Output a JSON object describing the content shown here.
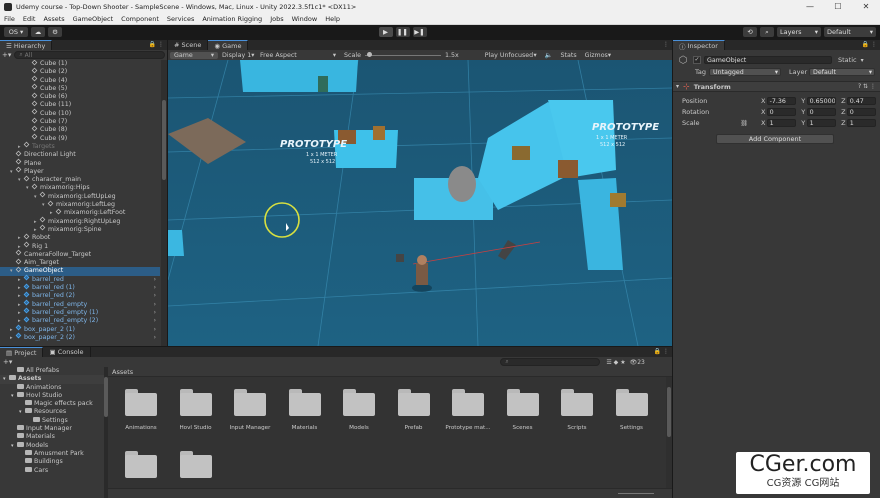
{
  "window": {
    "title": "Udemy course - Top-Down Shooter - SampleScene - Windows, Mac, Linux - Unity 2022.3.5f1c1* <DX11>"
  },
  "menu": [
    "File",
    "Edit",
    "Assets",
    "GameObject",
    "Component",
    "Services",
    "Animation Rigging",
    "Jobs",
    "Window",
    "Help"
  ],
  "toolbar": {
    "account": "OS",
    "layers": "Layers",
    "layout": "Default"
  },
  "hierarchy": {
    "tab": "Hierarchy",
    "search": "All",
    "rows": [
      {
        "t": "Cube (1)",
        "i": 4,
        "k": "n"
      },
      {
        "t": "Cube (2)",
        "i": 4,
        "k": "n"
      },
      {
        "t": "Cube (4)",
        "i": 4,
        "k": "n"
      },
      {
        "t": "Cube (5)",
        "i": 4,
        "k": "n"
      },
      {
        "t": "Cube (6)",
        "i": 4,
        "k": "n"
      },
      {
        "t": "Cube (11)",
        "i": 4,
        "k": "n"
      },
      {
        "t": "Cube (10)",
        "i": 4,
        "k": "n"
      },
      {
        "t": "Cube (7)",
        "i": 4,
        "k": "n"
      },
      {
        "t": "Cube (8)",
        "i": 4,
        "k": "n"
      },
      {
        "t": "Cube (9)",
        "i": 4,
        "k": "n"
      },
      {
        "t": "Targets",
        "i": 3,
        "k": "d",
        "a": "▸"
      },
      {
        "t": "Directional Light",
        "i": 2,
        "k": "n"
      },
      {
        "t": "Plane",
        "i": 2,
        "k": "n"
      },
      {
        "t": "Player",
        "i": 2,
        "k": "n",
        "a": "▾"
      },
      {
        "t": "character_main",
        "i": 3,
        "k": "n",
        "a": "▾"
      },
      {
        "t": "mixamorig:Hips",
        "i": 4,
        "k": "n",
        "a": "▾"
      },
      {
        "t": "mixamorig:LeftUpLeg",
        "i": 5,
        "k": "n",
        "a": "▾"
      },
      {
        "t": "mixamorig:LeftLeg",
        "i": 6,
        "k": "n",
        "a": "▾"
      },
      {
        "t": "mixamorig:LeftFoot",
        "i": 7,
        "k": "n",
        "a": "▸"
      },
      {
        "t": "mixamorig:RightUpLeg",
        "i": 5,
        "k": "n",
        "a": "▸"
      },
      {
        "t": "mixamorig:Spine",
        "i": 5,
        "k": "n",
        "a": "▸"
      },
      {
        "t": "Robot",
        "i": 3,
        "k": "n",
        "a": "▸"
      },
      {
        "t": "Rig 1",
        "i": 3,
        "k": "n",
        "a": "▸"
      },
      {
        "t": "CameraFollow_Target",
        "i": 2,
        "k": "n"
      },
      {
        "t": "Aim_Target",
        "i": 2,
        "k": "n"
      },
      {
        "t": "GameObject",
        "i": 2,
        "k": "s",
        "a": "▾"
      },
      {
        "t": "barrel_red",
        "i": 3,
        "k": "p",
        "a": "▸"
      },
      {
        "t": "barrel_red (1)",
        "i": 3,
        "k": "p",
        "a": "▸"
      },
      {
        "t": "barrel_red (2)",
        "i": 3,
        "k": "p",
        "a": "▸"
      },
      {
        "t": "barrel_red_empty",
        "i": 3,
        "k": "p",
        "a": "▸"
      },
      {
        "t": "barrel_red_empty (1)",
        "i": 3,
        "k": "p",
        "a": "▸"
      },
      {
        "t": "barrel_red_empty (2)",
        "i": 3,
        "k": "p",
        "a": "▸"
      },
      {
        "t": "box_paper_2 (1)",
        "i": 2,
        "k": "p",
        "a": "▸"
      },
      {
        "t": "box_paper_2 (2)",
        "i": 2,
        "k": "p",
        "a": "▸"
      }
    ]
  },
  "game": {
    "tabs": [
      "Scene",
      "Game"
    ],
    "mode": "Game",
    "display": "Display 1",
    "aspect": "Free Aspect",
    "scale_label": "Scale",
    "scale_value": "1.5x",
    "play_mode": "Play Unfocused",
    "stats": "Stats",
    "gizmos": "Gizmos",
    "labels": [
      "PROTOTYPE",
      "1 x 1 METER",
      "512 x 512"
    ]
  },
  "inspector": {
    "tab": "Inspector",
    "name": "GameObject",
    "static": "Static",
    "tag_label": "Tag",
    "tag": "Untagged",
    "layer_label": "Layer",
    "layer": "Default",
    "component": "Transform",
    "position": {
      "label": "Position",
      "x": "-7.36",
      "y": "0.650000",
      "z": "0.47"
    },
    "rotation": {
      "label": "Rotation",
      "x": "0",
      "y": "0",
      "z": "0"
    },
    "scale": {
      "label": "Scale",
      "x": "1",
      "y": "1",
      "z": "1"
    },
    "axes": [
      "X",
      "Y",
      "Z"
    ],
    "add_component": "Add Component"
  },
  "project": {
    "tabs": [
      "Project",
      "Console"
    ],
    "tree": [
      {
        "t": "All Prefabs",
        "i": 1
      },
      {
        "t": "Assets",
        "i": 0,
        "a": "▾",
        "b": true
      },
      {
        "t": "Animations",
        "i": 1
      },
      {
        "t": "Hovl Studio",
        "i": 1,
        "a": "▾"
      },
      {
        "t": "Magic effects pack",
        "i": 2
      },
      {
        "t": "Resources",
        "i": 2,
        "a": "▾"
      },
      {
        "t": "Settings",
        "i": 3
      },
      {
        "t": "Input Manager",
        "i": 1
      },
      {
        "t": "Materials",
        "i": 1
      },
      {
        "t": "Models",
        "i": 1,
        "a": "▾"
      },
      {
        "t": "Amusment Park",
        "i": 2
      },
      {
        "t": "Buildings",
        "i": 2
      },
      {
        "t": "Cars",
        "i": 2
      }
    ],
    "breadcrumb": "Assets",
    "count": "23",
    "items": [
      "Animations",
      "Hovl Studio",
      "Input Manager",
      "Materials",
      "Models",
      "Prefab",
      "Prototype mat...",
      "Scenes",
      "Scripts",
      "Settings",
      "",
      ""
    ]
  },
  "watermark": {
    "main": "CGer.com",
    "sub": "CG资源 CG网站"
  }
}
